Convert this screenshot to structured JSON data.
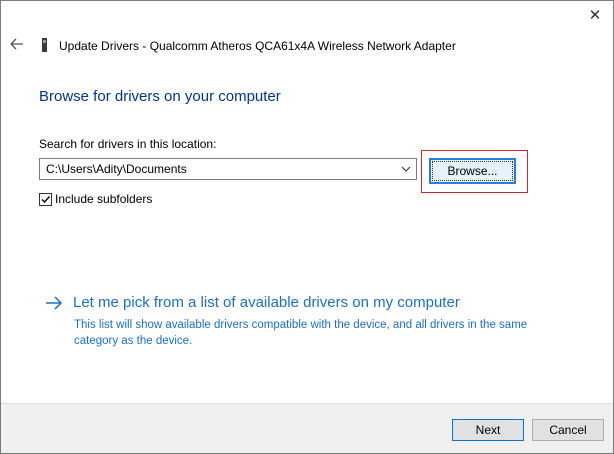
{
  "window": {
    "title": "Update Drivers - Qualcomm Atheros QCA61x4A Wireless Network Adapter",
    "back_icon": "back-arrow-icon",
    "close_icon": "close-icon",
    "device_icon": "network-adapter-icon"
  },
  "main": {
    "heading": "Browse for drivers on your computer",
    "search_label": "Search for drivers in this location:",
    "path_value": "C:\\Users\\Adity\\Documents",
    "browse_label": "Browse...",
    "include_subfolders_label": "Include subfolders",
    "include_subfolders_checked": true,
    "pick_link": "Let me pick from a list of available drivers on my computer",
    "pick_desc": "This list will show available drivers compatible with the device, and all drivers in the same category as the device."
  },
  "footer": {
    "next_label": "Next",
    "cancel_label": "Cancel"
  },
  "colors": {
    "heading": "#003399",
    "link": "#1a6fcf",
    "highlight_border": "#d9262c",
    "focus_border": "#2a7dd6"
  }
}
